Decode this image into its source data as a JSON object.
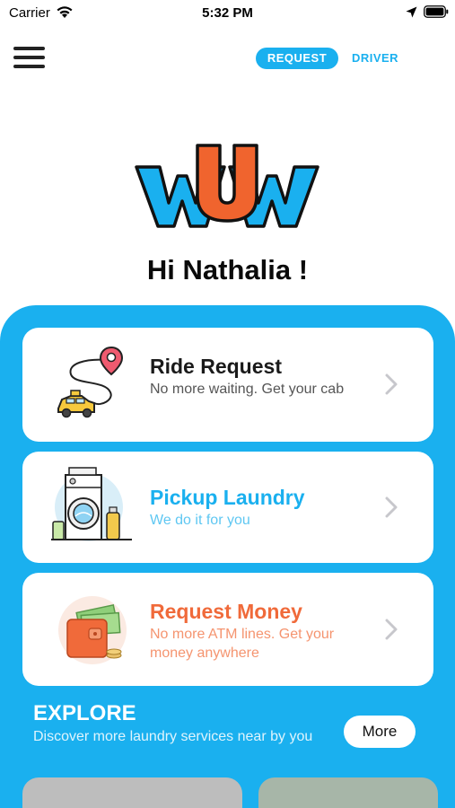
{
  "status_bar": {
    "carrier": "Carrier",
    "time": "5:32 PM",
    "icons": [
      "wifi-icon",
      "location-arrow-icon",
      "battery-icon"
    ]
  },
  "header": {
    "menu_icon": "hamburger-menu-icon",
    "segment_request": "REQUEST",
    "segment_driver": "DRIVER",
    "selected_segment": "REQUEST"
  },
  "logo": {
    "text": "wUw"
  },
  "greeting": "Hi Nathalia !",
  "cards": [
    {
      "title": "Ride Request",
      "subtitle": "No more waiting. Get your cab",
      "title_color": "#1a1a1a",
      "subtitle_color": "#555555",
      "icon": "taxi-route-icon"
    },
    {
      "title": "Pickup Laundry",
      "subtitle": "We do it for you",
      "title_color": "#1ab0ef",
      "subtitle_color": "#5ec7f2",
      "icon": "washing-machine-icon"
    },
    {
      "title": "Request Money",
      "subtitle": "No more ATM lines. Get your money anywhere",
      "title_color": "#f06a3a",
      "subtitle_color": "#f5946f",
      "icon": "wallet-money-icon"
    }
  ],
  "explore": {
    "title": "EXPLORE",
    "subtitle": "Discover more laundry services near by you",
    "more_label": "More"
  },
  "colors": {
    "primary_blue": "#1ab0ef",
    "accent_orange": "#f06a3a",
    "logo_blue": "#1ab0ef",
    "logo_orange": "#f0642e"
  }
}
